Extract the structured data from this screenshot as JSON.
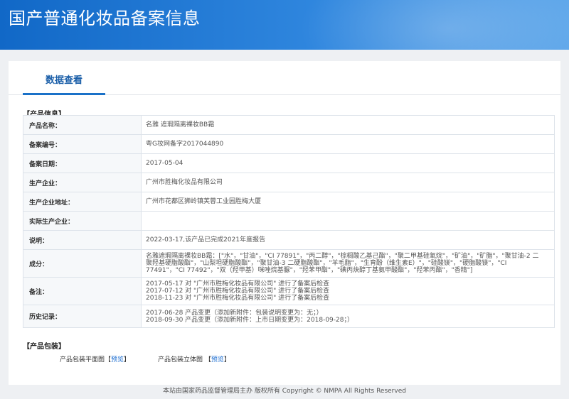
{
  "header": {
    "title": "国产普通化妆品备案信息"
  },
  "tabs": [
    {
      "label": "数据查看"
    }
  ],
  "product_info": {
    "section_title": "【产品信息】",
    "rows": [
      {
        "label": "产品名称：",
        "lines": [
          "名雅 遮瑕隔离裸妆BB霜"
        ]
      },
      {
        "label": "备案编号：",
        "lines": [
          "粤G妆网备字2017044890"
        ]
      },
      {
        "label": "备案日期：",
        "lines": [
          "2017-05-04"
        ]
      },
      {
        "label": "生产企业：",
        "lines": [
          "广州市胜梅化妆品有限公司"
        ]
      },
      {
        "label": "生产企业地址：",
        "lines": [
          "广州市花都区狮岭镇芙蓉工业园胜梅大厦"
        ]
      },
      {
        "label": "实际生产企业：",
        "lines": [
          ""
        ]
      },
      {
        "label": "说明：",
        "lines": [
          "2022-03-17,该产品已完成2021年度报告"
        ]
      },
      {
        "label": "成分：",
        "lines": [
          "名雅遮瑕隔离裸妆BB霜：[\"水\"，\"甘油\"，\"CI 77891\"，\"丙二醇\"，\"棕榈酸乙基己酯\"，\"聚二甲基硅氧烷\"，\"矿油\"，\"矿脂\"，\"聚甘油-2 二",
          "聚羟基硬脂酸酯\"，\"山梨坦硬脂酸酯\"，\"聚甘油-3 二硬脂酸酯\"，\"羊毛脂\"，\"生育酚（维生素E）\"，\"硅酸镁\"，\"硬脂酸镁\"，\"CI",
          "77491\"，\"CI 77492\"，\"双（羟甲基）咪唑烷基脲\"，\"羟苯甲酯\"，\"碘丙炔醇丁基氨甲酸酯\"，\"羟苯丙酯\"，\"香精\"]"
        ]
      },
      {
        "label": "备注：",
        "lines": [
          "2017-05-17 对 \"广州市胜梅化妆品有限公司\" 进行了备案后检查",
          "2017-07-12 对 \"广州市胜梅化妆品有限公司\" 进行了备案后检查",
          "2018-11-23 对 \"广州市胜梅化妆品有限公司\" 进行了备案后检查"
        ]
      },
      {
        "label": "历史记录：",
        "lines": [
          "2017-06-28 产品变更（添加新附件：包装说明变更为：无；）",
          "2018-09-30 产品变更（添加新附件：上市日期变更为：2018-09-28；）"
        ]
      }
    ]
  },
  "packaging": {
    "section_title": "【产品包装】",
    "items": [
      {
        "label": "产品包装平面图",
        "link": "预览"
      },
      {
        "label": "产品包装立体图",
        "link": "预览"
      }
    ]
  },
  "footer": {
    "text": "本站由国家药品监督管理局主办 版权所有 Copyright © NMPA All Rights Reserved"
  },
  "colors": {
    "banner": "#1a71c8",
    "accent": "#1a5ea8",
    "link": "#1f6fd1"
  }
}
